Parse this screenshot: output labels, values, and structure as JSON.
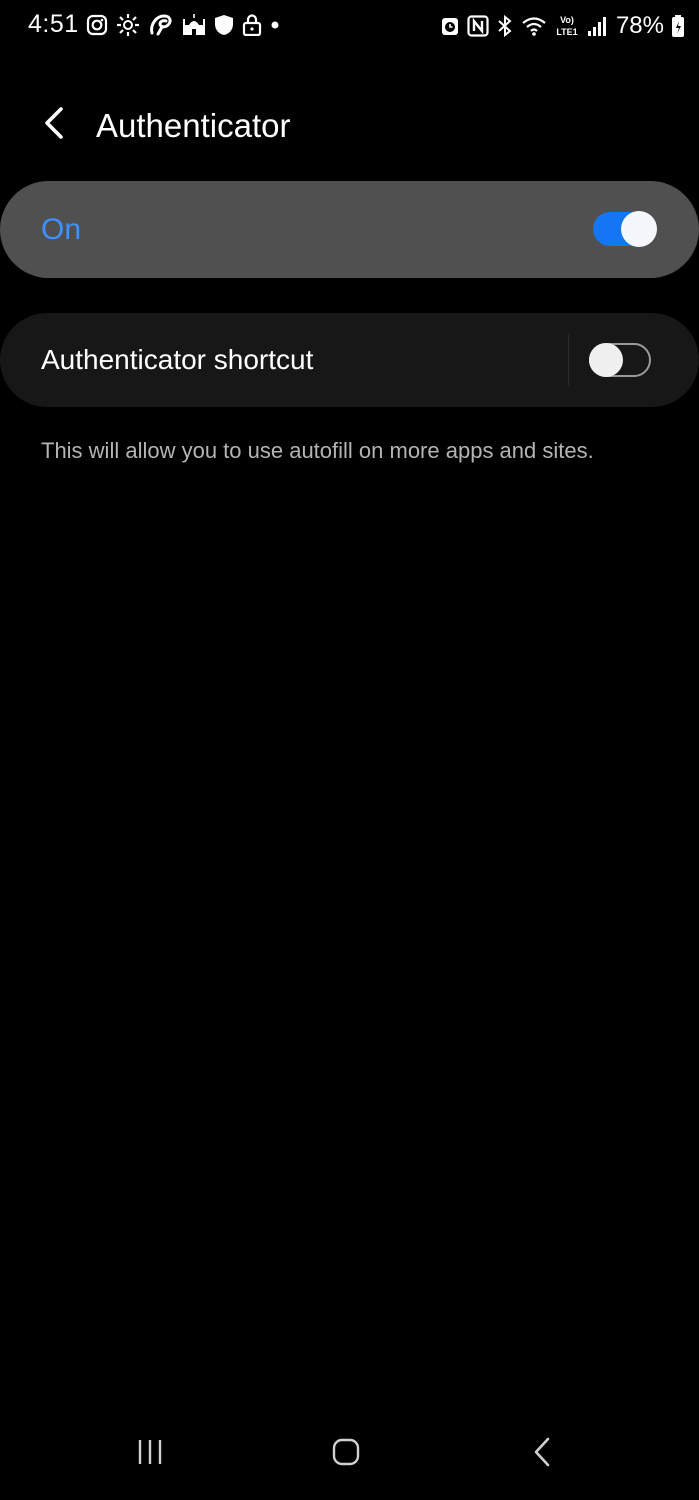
{
  "status_bar": {
    "time": "4:51",
    "battery": "78%",
    "left_icons": [
      "instagram-icon",
      "settings-gear-icon",
      "airtel-icon",
      "mosque-icon",
      "shield-icon",
      "lock-icon",
      "dot-icon"
    ],
    "right_icons": [
      "alarm-icon",
      "nfc-icon",
      "bluetooth-icon",
      "wifi-icon",
      "volte-icon",
      "signal-icon",
      "battery-icon"
    ]
  },
  "header": {
    "title": "Authenticator",
    "back_icon": "chevron-left-icon"
  },
  "master_switch": {
    "label": "On",
    "state": "on",
    "label_color": "#3e91ff",
    "track_color": "#1476f2"
  },
  "shortcut": {
    "label": "Authenticator shortcut",
    "state": "off"
  },
  "description": "This will allow you to use autofill on more apps and sites.",
  "nav": {
    "recents_icon": "recents-icon",
    "home_icon": "home-icon",
    "back_icon": "back-icon"
  }
}
